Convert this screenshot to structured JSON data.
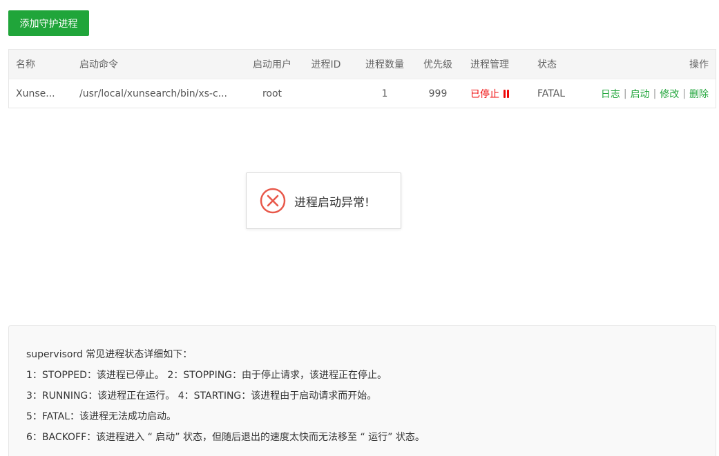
{
  "toolbar": {
    "add_label": "添加守护进程"
  },
  "table": {
    "headers": {
      "name": "名称",
      "command": "启动命令",
      "user": "启动用户",
      "pid": "进程ID",
      "count": "进程数量",
      "priority": "优先级",
      "manage": "进程管理",
      "status": "状态",
      "ops": "操作"
    },
    "rows": [
      {
        "name": "Xunse...",
        "command": "/usr/local/xunsearch/bin/xs-c...",
        "user": "root",
        "pid": "",
        "count": "1",
        "priority": "999",
        "manage": "已停止",
        "status": "FATAL",
        "ops": {
          "log": "日志",
          "start": "启动",
          "edit": "修改",
          "delete": "删除",
          "separator": "|"
        }
      }
    ]
  },
  "toast": {
    "message": "进程启动异常!",
    "icon": "error-circle-icon"
  },
  "info": {
    "lines": [
      "supervisord 常见进程状态详细如下：",
      "1：STOPPED：该进程已停止。      2：STOPPING：由于停止请求，该进程正在停止。",
      "3：RUNNING：该进程正在运行。 4：STARTING：该进程由于启动请求而开始。",
      "5：FATAL：该进程无法成功启动。",
      "6：BACKOFF：该进程进入 “ 启动” 状态，但随后退出的速度太快而无法移至 “ 运行” 状态。"
    ]
  },
  "colors": {
    "accent": "#20a53a",
    "error": "#ef0808",
    "toast_icon": "#e8584a"
  }
}
